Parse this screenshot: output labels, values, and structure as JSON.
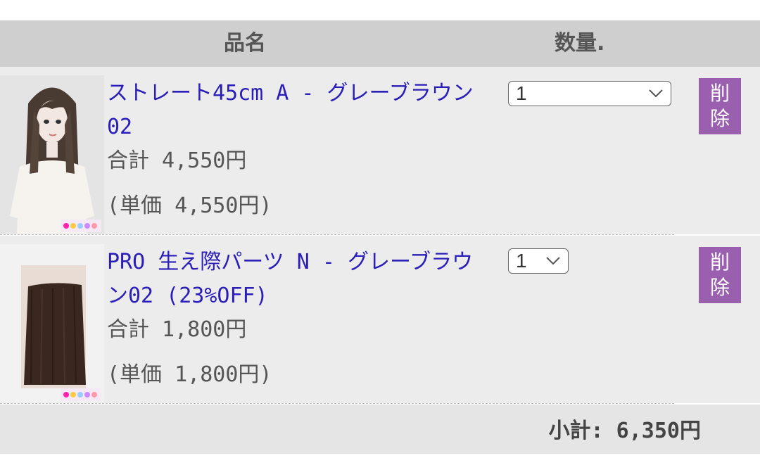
{
  "header": {
    "name_label": "品名",
    "qty_label": "数量."
  },
  "items": [
    {
      "title": "ストレート45cm A - グレーブラウン02",
      "total": "合計 4,550円",
      "unit": "(単価 4,550円)",
      "qty": "1",
      "delete_top": "削",
      "delete_bottom": "除"
    },
    {
      "title": "PRO 生え際パーツ N - グレーブラウン02 (23%OFF)",
      "total": "合計 1,800円",
      "unit": "(単価 1,800円)",
      "qty": "1",
      "delete_top": "削",
      "delete_bottom": "除"
    }
  ],
  "subtotal": "小計: 6,350円",
  "colors": {
    "link": "#2a1db8",
    "delete_button": "#9b5fb0",
    "header_bg": "#cfcfcf"
  }
}
